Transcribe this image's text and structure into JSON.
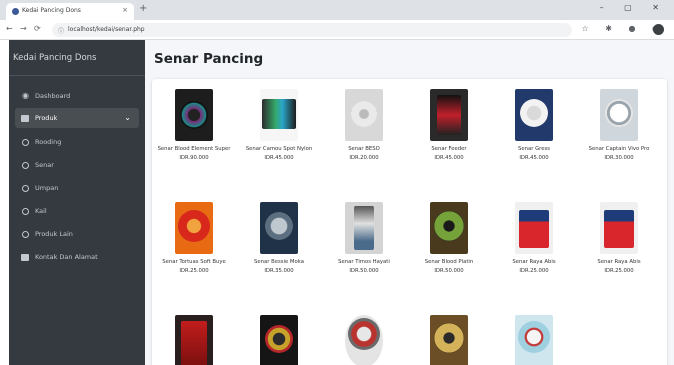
{
  "browser": {
    "tab_title": "Kedai Pancing Dons",
    "tab_close": "×",
    "new_tab": "+",
    "window_controls": "–  ▢  ✕",
    "nav_back": "←",
    "nav_forward": "→",
    "nav_reload": "⟳",
    "lock": "ⓘ",
    "url": "localhost/kedai/senar.php",
    "toolbar_icons": "☆ ✱ ● ●"
  },
  "sidebar": {
    "brand": "Kedai Pancing Dons",
    "items": [
      {
        "label": "Dashboard",
        "icon": "tachometer-icon"
      },
      {
        "label": "Produk",
        "icon": "box-icon",
        "active": true,
        "chevron": "⌄"
      },
      {
        "label": "Rooding",
        "icon": "circle-icon"
      },
      {
        "label": "Senar",
        "icon": "circle-icon"
      },
      {
        "label": "Umpan",
        "icon": "circle-icon"
      },
      {
        "label": "Kail",
        "icon": "circle-icon"
      },
      {
        "label": "Produk Lain",
        "icon": "circle-icon"
      },
      {
        "label": "Kontak Dan Alamat",
        "icon": "address-card-icon"
      }
    ]
  },
  "main": {
    "title": "Senar Pancing",
    "products": [
      {
        "name": "Senar Blood Element Super",
        "price": "IDR.90.000"
      },
      {
        "name": "Senar Camou Spot Nylon",
        "price": "IDR.45.000"
      },
      {
        "name": "Senar BESO",
        "price": "IDR.20.000"
      },
      {
        "name": "Senar Feeder",
        "price": "IDR.45.000"
      },
      {
        "name": "Senar Gress",
        "price": "IDR.45.000"
      },
      {
        "name": "Senar Captain Vivo Pro",
        "price": "IDR.30.000"
      },
      {
        "name": "Senar Tortuas Soft Buye",
        "price": "IDR.25.000"
      },
      {
        "name": "Senar Bessie Moka",
        "price": "IDR.35.000"
      },
      {
        "name": "Senar Timos Hayati",
        "price": "IDR.50.000"
      },
      {
        "name": "Senar Blood Platin",
        "price": "IDR.50.000"
      },
      {
        "name": "Senar Raya Abis",
        "price": "IDR.25.000"
      },
      {
        "name": "Senar Raya Abis",
        "price": "IDR.25.000"
      },
      {
        "name": "",
        "price": ""
      },
      {
        "name": "",
        "price": ""
      },
      {
        "name": "",
        "price": ""
      },
      {
        "name": "",
        "price": ""
      },
      {
        "name": "",
        "price": ""
      }
    ]
  },
  "colors": {
    "sidebar_bg": "#343a40",
    "active_item_bg": "#494e53",
    "content_bg": "#f4f6f9"
  }
}
